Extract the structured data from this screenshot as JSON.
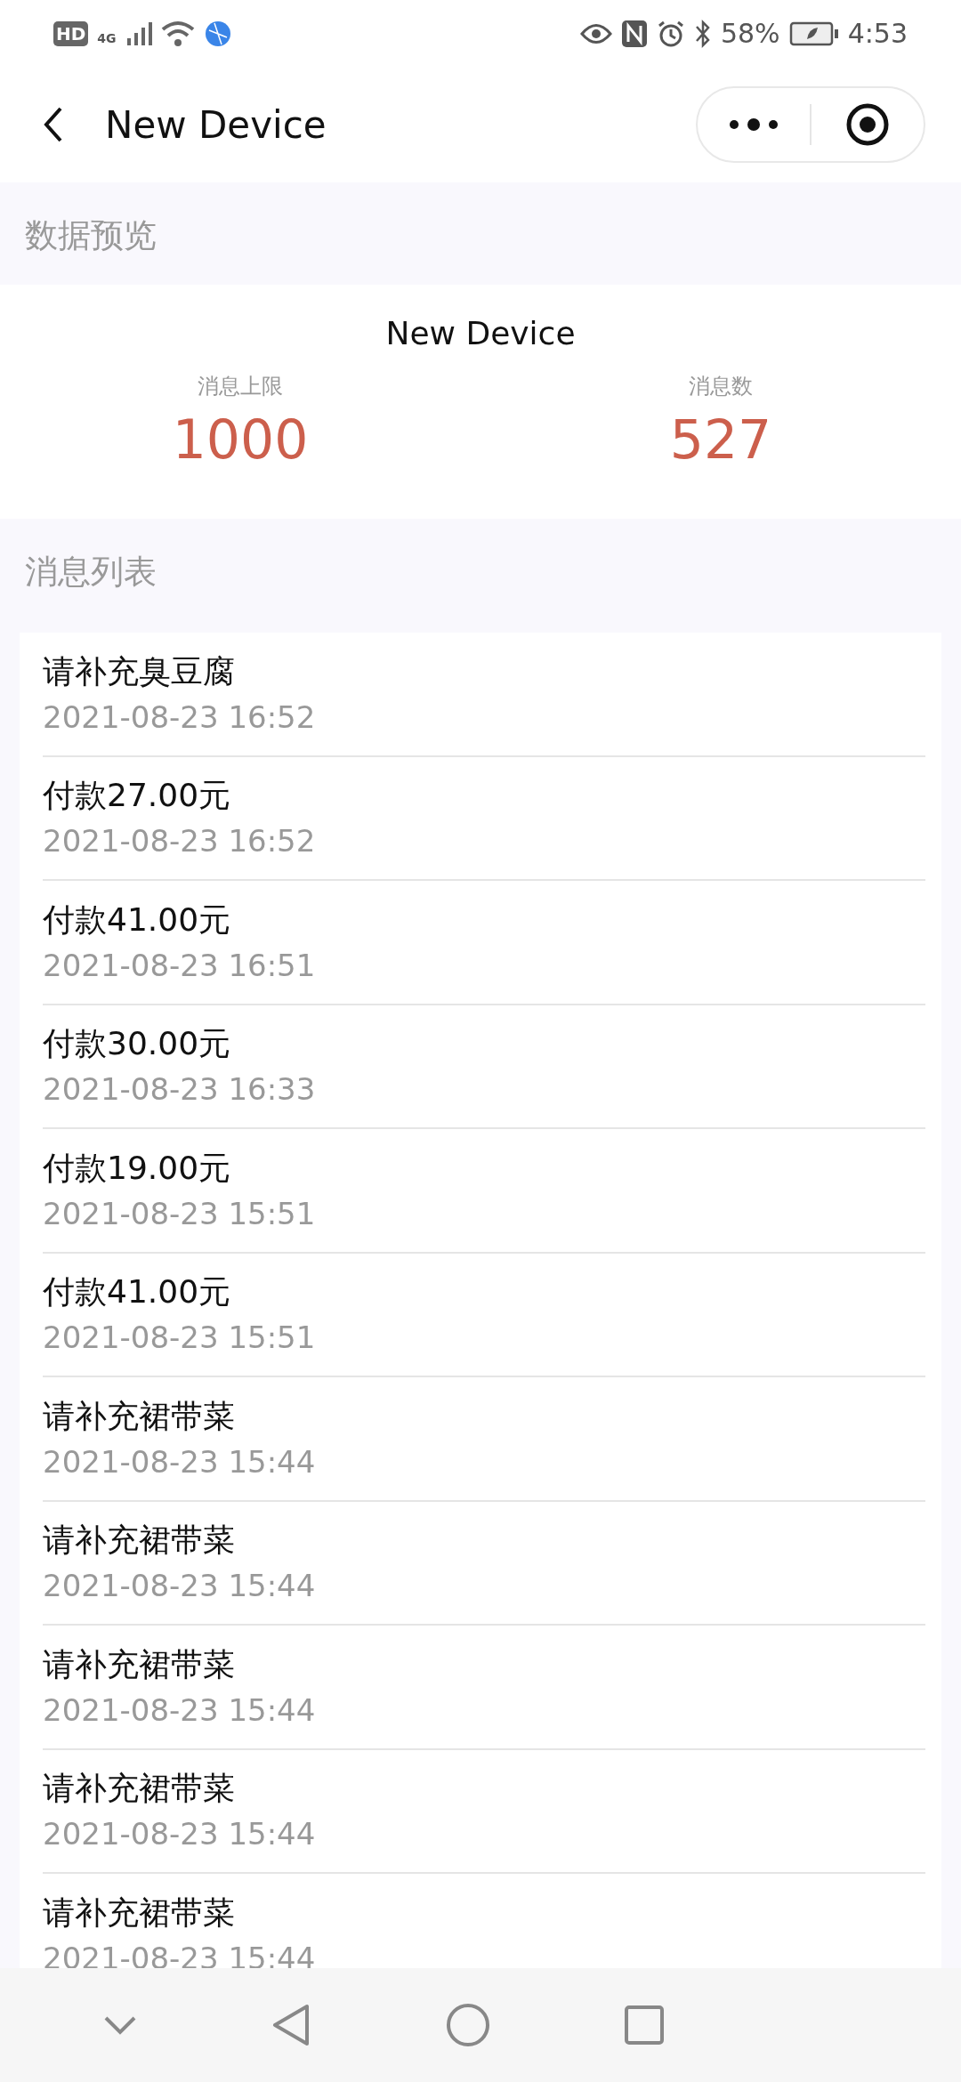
{
  "status_bar": {
    "network_badge": "HD",
    "network_type": "4G",
    "battery": "58%",
    "time": "4:53"
  },
  "header": {
    "title": "New Device"
  },
  "preview": {
    "section_title": "数据预览",
    "device_name": "New Device",
    "stats": [
      {
        "label": "消息上限",
        "value": "1000"
      },
      {
        "label": "消息数",
        "value": "527"
      }
    ]
  },
  "messages": {
    "section_title": "消息列表",
    "items": [
      {
        "text": "请补充臭豆腐",
        "time": "2021-08-23 16:52"
      },
      {
        "text": "付款27.00元",
        "time": "2021-08-23 16:52"
      },
      {
        "text": "付款41.00元",
        "time": "2021-08-23 16:51"
      },
      {
        "text": "付款30.00元",
        "time": "2021-08-23 16:33"
      },
      {
        "text": "付款19.00元",
        "time": "2021-08-23 15:51"
      },
      {
        "text": "付款41.00元",
        "time": "2021-08-23 15:51"
      },
      {
        "text": "请补充裙带菜",
        "time": "2021-08-23 15:44"
      },
      {
        "text": "请补充裙带菜",
        "time": "2021-08-23 15:44"
      },
      {
        "text": "请补充裙带菜",
        "time": "2021-08-23 15:44"
      },
      {
        "text": "请补充裙带菜",
        "time": "2021-08-23 15:44"
      },
      {
        "text": "请补充裙带菜",
        "time": "2021-08-23 15:44"
      }
    ]
  }
}
